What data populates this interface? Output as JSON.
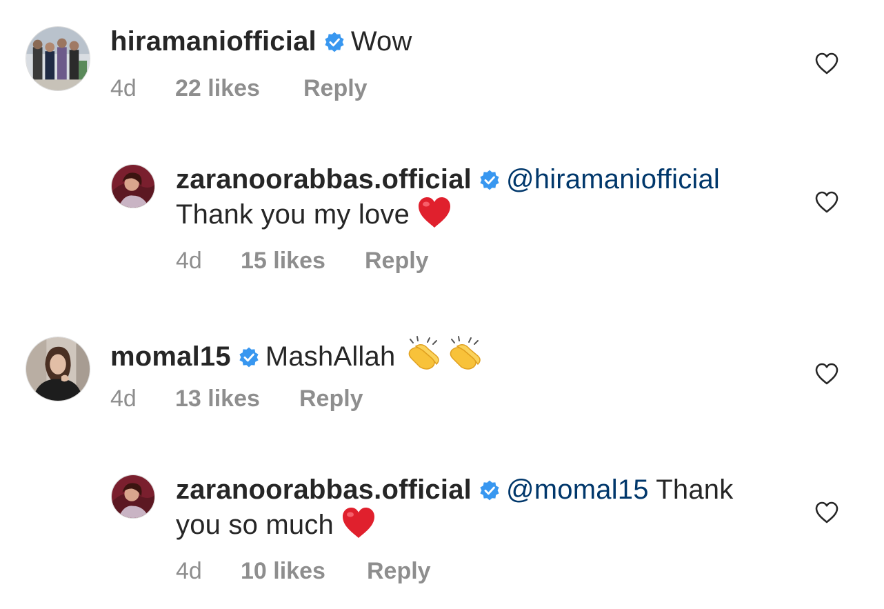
{
  "colors": {
    "verified": "#3897f0",
    "mention": "#00376b",
    "meta": "#8e8e8e",
    "heart_emoji": "#e0202d"
  },
  "comments": [
    {
      "username": "hiramaniofficial",
      "verified": true,
      "text": "Wow",
      "time": "4d",
      "likes": "22 likes",
      "reply": "Reply",
      "icons": {
        "avatar": "group-photo-avatar",
        "like": "heart-outline-icon"
      }
    },
    {
      "username": "zaranoorabbas.official",
      "verified": true,
      "mention": "@hiramaniofficial",
      "text": "Thank you my love",
      "emoji": "red-heart-emoji",
      "time": "4d",
      "likes": "15 likes",
      "reply": "Reply",
      "icons": {
        "avatar": "portrait-avatar",
        "like": "heart-outline-icon"
      }
    },
    {
      "username": "momal15",
      "verified": true,
      "text": "MashAllah",
      "emoji": "clapping-hands-emoji x2",
      "time": "4d",
      "likes": "13 likes",
      "reply": "Reply",
      "icons": {
        "avatar": "portrait-avatar",
        "like": "heart-outline-icon"
      }
    },
    {
      "username": "zaranoorabbas.official",
      "verified": true,
      "mention": "@momal15",
      "text_line1": "Thank",
      "text_line2": "you so much",
      "emoji": "red-heart-emoji",
      "time": "4d",
      "likes": "10 likes",
      "reply": "Reply",
      "icons": {
        "avatar": "portrait-avatar",
        "like": "heart-outline-icon"
      }
    }
  ]
}
